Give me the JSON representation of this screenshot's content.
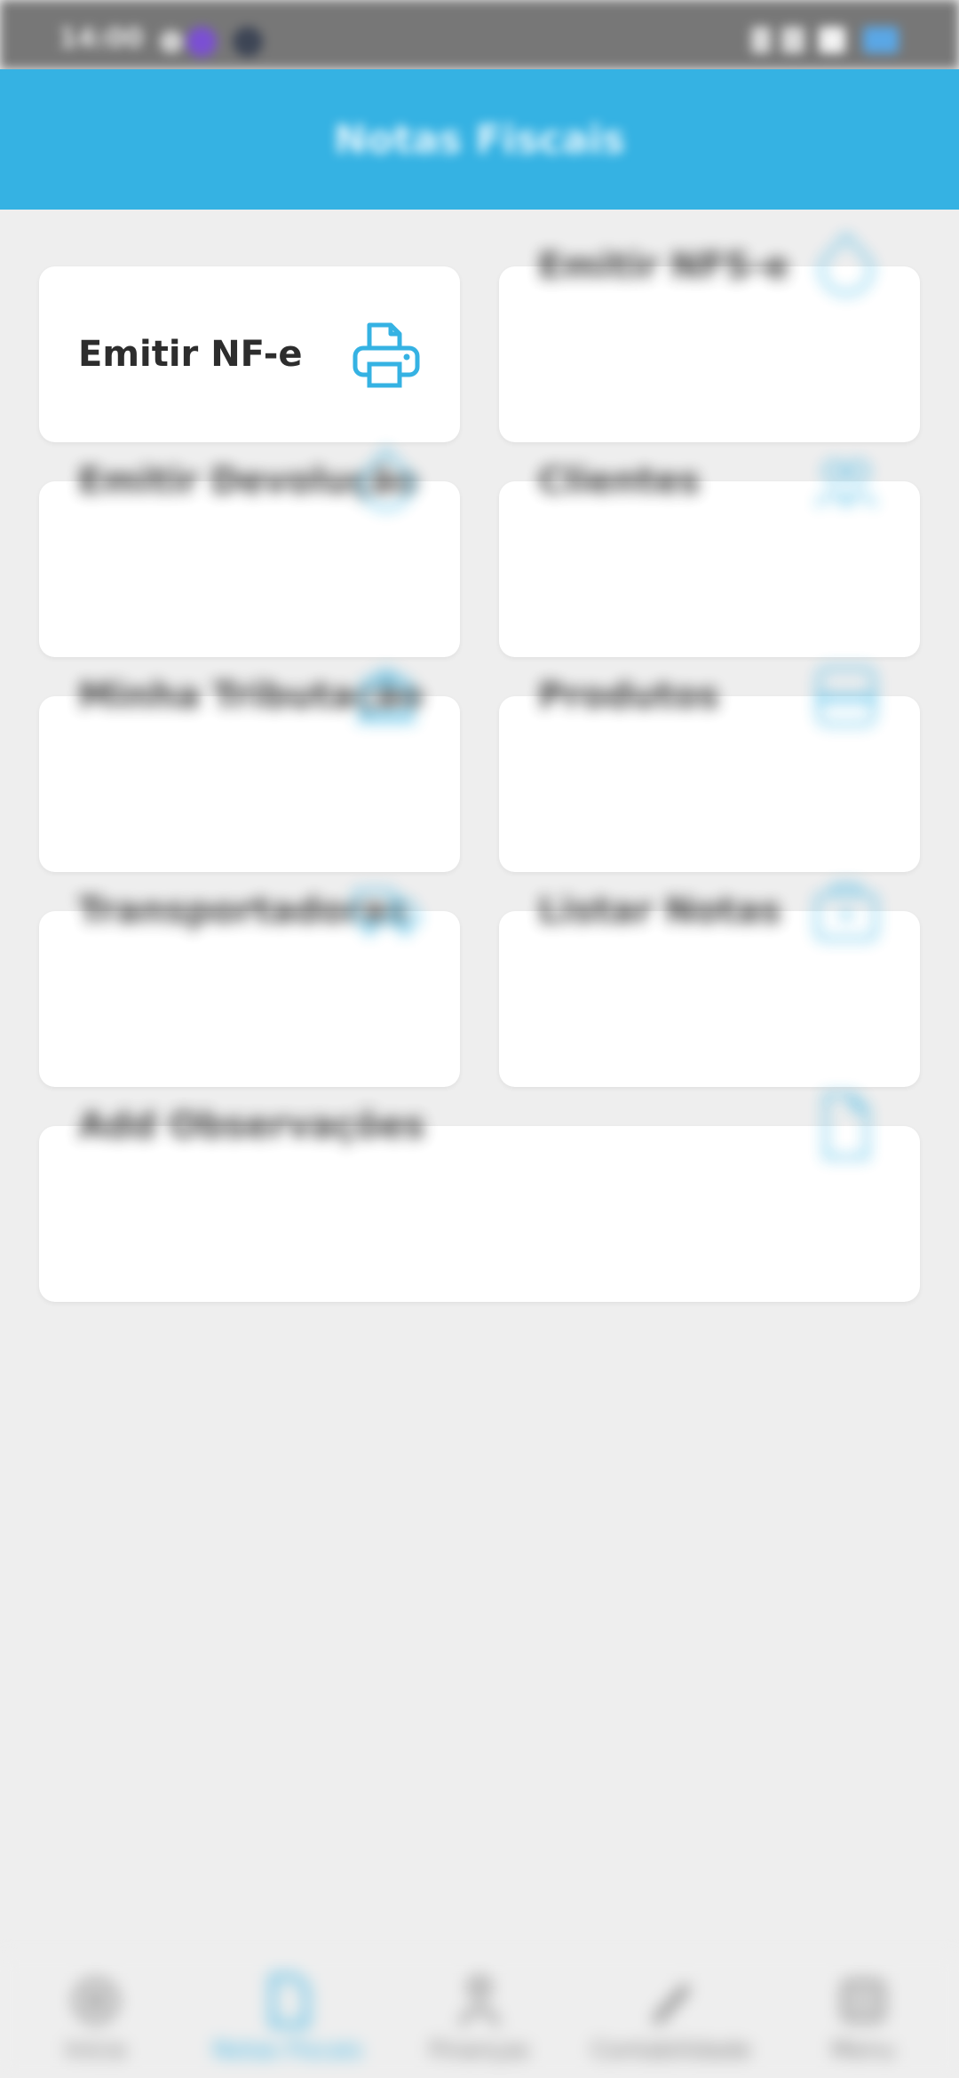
{
  "status_bar": {
    "time": "14:00"
  },
  "app_bar": {
    "title": "Notas Fiscais"
  },
  "cards": [
    {
      "label": "Emitir NF-e",
      "icon": "printer-icon"
    },
    {
      "label": "Emitir NFS-e",
      "icon": "document-icon"
    },
    {
      "label": "Emitir Devolução",
      "icon": "return-document-icon"
    },
    {
      "label": "Clientes",
      "icon": "users-icon"
    },
    {
      "label": "Minha Tributação",
      "icon": "bank-icon"
    },
    {
      "label": "Produtos",
      "icon": "box-icon"
    },
    {
      "label": "Transportadoras",
      "icon": "truck-icon"
    },
    {
      "label": "Listar Notas",
      "icon": "briefcase-icon"
    },
    {
      "label": "Add Observações",
      "icon": "file-icon"
    }
  ],
  "bottom_nav": [
    {
      "label": "Início",
      "icon": "home-icon",
      "active": false
    },
    {
      "label": "Notas Fiscais",
      "icon": "document-icon",
      "active": true
    },
    {
      "label": "Finanças",
      "icon": "person-icon",
      "active": false
    },
    {
      "label": "Contabilidade",
      "icon": "pen-icon",
      "active": false
    },
    {
      "label": "Menu",
      "icon": "menu-icon",
      "active": false
    }
  ],
  "colors": {
    "accent": "#35b2e3",
    "background": "#eeeeee",
    "status_bar": "#777777"
  }
}
